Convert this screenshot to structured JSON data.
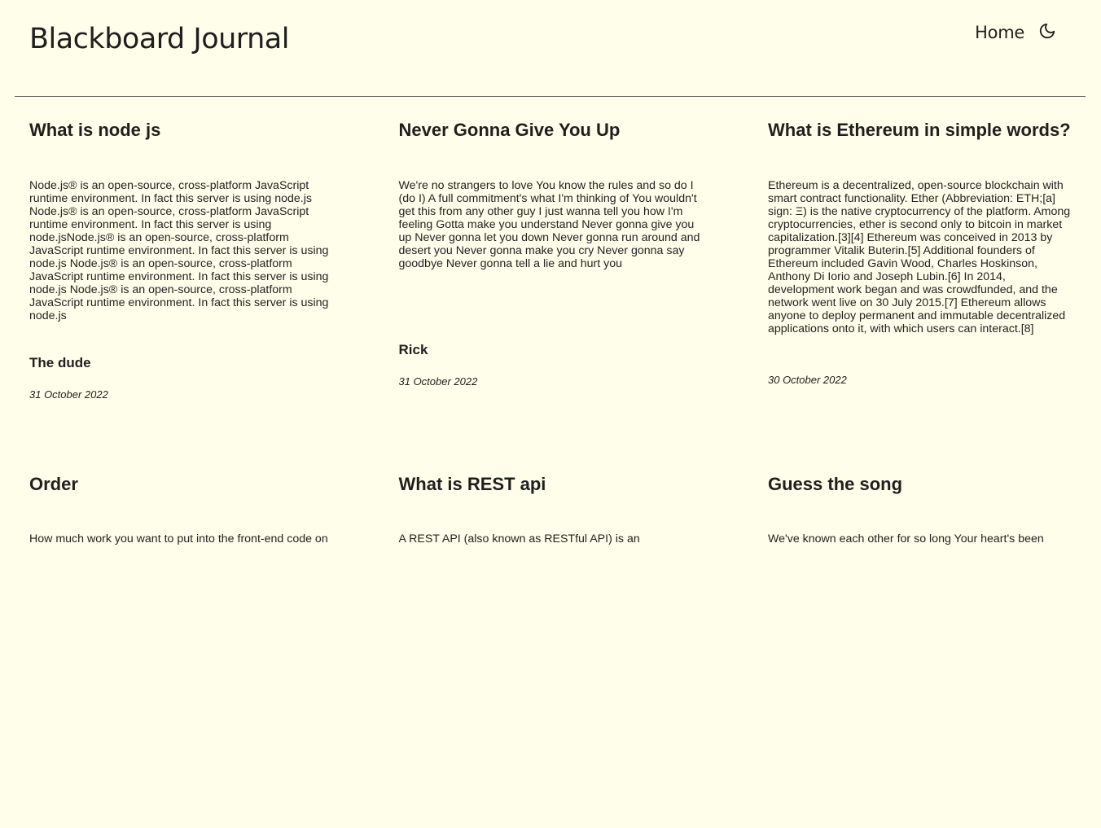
{
  "header": {
    "site_title": "Blackboard Journal",
    "nav_home": "Home",
    "theme_toggle_icon": "moon-icon"
  },
  "posts": [
    {
      "title": "What is node js",
      "body": "Node.js® is an open-source, cross-platform JavaScript runtime environment. In fact this server is using node.js Node.js® is an open-source, cross-platform JavaScript runtime environment. In fact this server is using node.jsNode.js® is an open-source, cross-platform JavaScript runtime environment. In fact this server is using node.js Node.js® is an open-source, cross-platform JavaScript runtime environment. In fact this server is using node.js Node.js® is an open-source, cross-platform JavaScript runtime environment. In fact this server is using node.js",
      "author": "The dude",
      "date": "31 October 2022"
    },
    {
      "title": "Never Gonna Give You Up",
      "body": "We're no strangers to love You know the rules and so do I (do I) A full commitment's what I'm thinking of You wouldn't get this from any other guy I just wanna tell you how I'm feeling Gotta make you understand Never gonna give you up Never gonna let you down Never gonna run around and desert you Never gonna make you cry Never gonna say goodbye Never gonna tell a lie and hurt you",
      "author": "Rick",
      "date": "31 October 2022"
    },
    {
      "title": "What is Ethereum in simple words?",
      "body": "Ethereum is a decentralized, open-source blockchain with smart contract functionality. Ether (Abbreviation: ETH;[a] sign: Ξ) is the native cryptocurrency of the platform. Among cryptocurrencies, ether is second only to bitcoin in market capitalization.[3][4] Ethereum was conceived in 2013 by programmer Vitalik Buterin.[5] Additional founders of Ethereum included Gavin Wood, Charles Hoskinson, Anthony Di Iorio and Joseph Lubin.[6] In 2014, development work began and was crowdfunded, and the network went live on 30 July 2015.[7] Ethereum allows anyone to deploy permanent and immutable decentralized applications onto it, with which users can interact.[8]",
      "author": "",
      "date": "30 October 2022"
    },
    {
      "title": "Order",
      "body": "How much work you want to put into the front-end code on",
      "author": "",
      "date": ""
    },
    {
      "title": "What is REST api",
      "body": "A REST API (also known as RESTful API) is an",
      "author": "",
      "date": ""
    },
    {
      "title": "Guess the song",
      "body": "We've known each other for so long Your heart's been",
      "author": "",
      "date": ""
    }
  ]
}
